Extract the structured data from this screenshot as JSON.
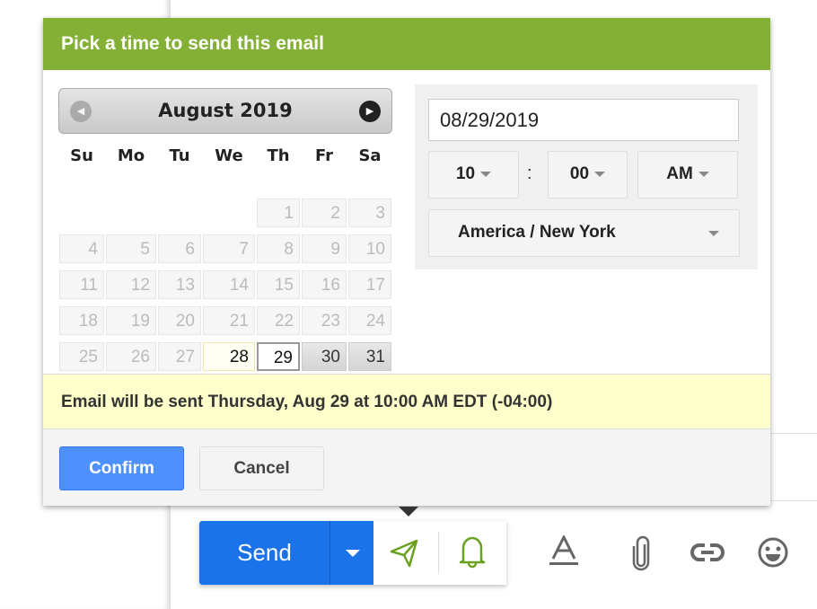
{
  "dialog": {
    "title": "Pick a time to send this email",
    "calendar": {
      "month_label": "August 2019",
      "weekdays": [
        "Su",
        "Mo",
        "Tu",
        "We",
        "Th",
        "Fr",
        "Sa"
      ],
      "days": [
        "1",
        "2",
        "3",
        "4",
        "5",
        "6",
        "7",
        "8",
        "9",
        "10",
        "11",
        "12",
        "13",
        "14",
        "15",
        "16",
        "17",
        "18",
        "19",
        "20",
        "21",
        "22",
        "23",
        "24",
        "25",
        "26",
        "27",
        "28",
        "29",
        "30",
        "31"
      ],
      "selected_day": "29",
      "today": "28"
    },
    "date_value": "08/29/2019",
    "hour": "10",
    "separator": ":",
    "minute": "00",
    "ampm": "AM",
    "timezone": "America / New York",
    "summary": "Email will be sent Thursday, Aug 29 at 10:00 AM EDT (-04:00)",
    "confirm_label": "Confirm",
    "cancel_label": "Cancel"
  },
  "compose": {
    "send_label": "Send",
    "accent": "#84b135",
    "send_color": "#1a73e8"
  }
}
